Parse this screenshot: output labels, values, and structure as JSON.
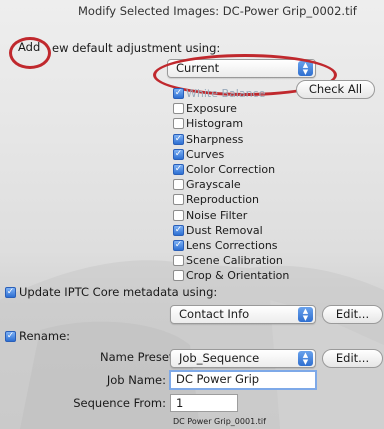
{
  "dialog": {
    "title": "Modify Selected Images: DC-Power Grip_0002.tif",
    "add_label": "Add",
    "using_label": "ew default adjustment using:",
    "adjustment_popup": "Current",
    "check_all_button": "Check All"
  },
  "adjustments": [
    {
      "label": "White Balance",
      "checked": true
    },
    {
      "label": "Exposure",
      "checked": false
    },
    {
      "label": "Histogram",
      "checked": false
    },
    {
      "label": "Sharpness",
      "checked": true
    },
    {
      "label": "Curves",
      "checked": true
    },
    {
      "label": "Color Correction",
      "checked": true
    },
    {
      "label": "Grayscale",
      "checked": false
    },
    {
      "label": "Reproduction",
      "checked": false
    },
    {
      "label": "Noise Filter",
      "checked": false
    },
    {
      "label": "Dust Removal",
      "checked": true
    },
    {
      "label": "Lens Corrections",
      "checked": true
    },
    {
      "label": "Scene Calibration",
      "checked": false
    },
    {
      "label": "Crop & Orientation",
      "checked": false
    }
  ],
  "iptc": {
    "checkbox_label": "Update IPTC Core metadata using:",
    "checked": true,
    "popup_value": "Contact Info",
    "edit_button": "Edit..."
  },
  "rename": {
    "checkbox_label": "Rename:",
    "checked": true,
    "name_preset_label": "Name Preset:",
    "name_preset_value": "Job_Sequence",
    "edit_button": "Edit...",
    "job_name_label": "Job Name:",
    "job_name_value": "DC Power Grip",
    "sequence_from_label": "Sequence From:",
    "sequence_from_value": "1",
    "example_filename": "DC Power Grip_0001.tif"
  },
  "colors": {
    "annotation_red": "#c0282d",
    "checkbox_blue": "#2d6fd2"
  }
}
